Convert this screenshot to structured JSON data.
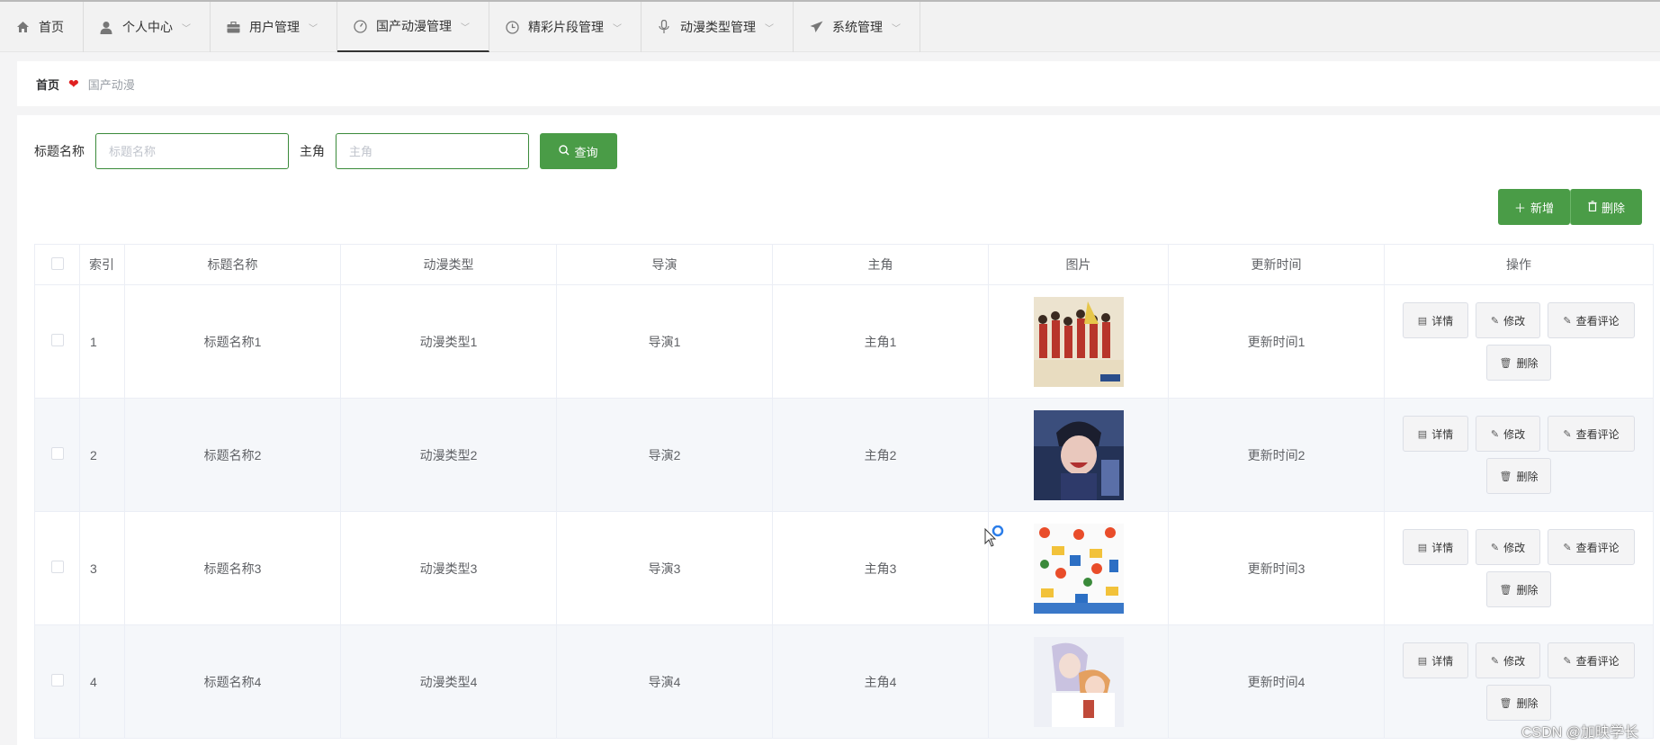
{
  "nav": {
    "items": [
      {
        "label": "首页",
        "icon": "home-icon",
        "has_chevron": false
      },
      {
        "label": "个人中心",
        "icon": "user-icon",
        "has_chevron": true
      },
      {
        "label": "用户管理",
        "icon": "briefcase-icon",
        "has_chevron": true
      },
      {
        "label": "国产动漫管理",
        "icon": "gauge-icon",
        "has_chevron": true,
        "active": true
      },
      {
        "label": "精彩片段管理",
        "icon": "clock-icon",
        "has_chevron": true
      },
      {
        "label": "动漫类型管理",
        "icon": "microphone-icon",
        "has_chevron": true
      },
      {
        "label": "系统管理",
        "icon": "send-icon",
        "has_chevron": true
      }
    ]
  },
  "breadcrumb": {
    "home": "首页",
    "current": "国产动漫"
  },
  "search": {
    "title_label": "标题名称",
    "title_placeholder": "标题名称",
    "title_value": "",
    "lead_label": "主角",
    "lead_placeholder": "主角",
    "lead_value": "",
    "query_button": "查询"
  },
  "actions": {
    "add": "新增",
    "delete": "删除"
  },
  "table": {
    "headers": [
      "索引",
      "标题名称",
      "动漫类型",
      "导演",
      "主角",
      "图片",
      "更新时间",
      "操作"
    ],
    "rows": [
      {
        "index": "1",
        "title": "标题名称1",
        "type": "动漫类型1",
        "director": "导演1",
        "lead": "主角1",
        "updated": "更新时间1"
      },
      {
        "index": "2",
        "title": "标题名称2",
        "type": "动漫类型2",
        "director": "导演2",
        "lead": "主角2",
        "updated": "更新时间2"
      },
      {
        "index": "3",
        "title": "标题名称3",
        "type": "动漫类型3",
        "director": "导演3",
        "lead": "主角3",
        "updated": "更新时间3"
      },
      {
        "index": "4",
        "title": "标题名称4",
        "type": "动漫类型4",
        "director": "导演4",
        "lead": "主角4",
        "updated": "更新时间4"
      }
    ],
    "row_buttons": {
      "detail": "详情",
      "edit": "修改",
      "comments": "查看评论",
      "delete": "删除"
    }
  },
  "watermark": "CSDN @加映学长",
  "colors": {
    "primary_green": "#4a9c47",
    "heart_red": "#e02020"
  }
}
